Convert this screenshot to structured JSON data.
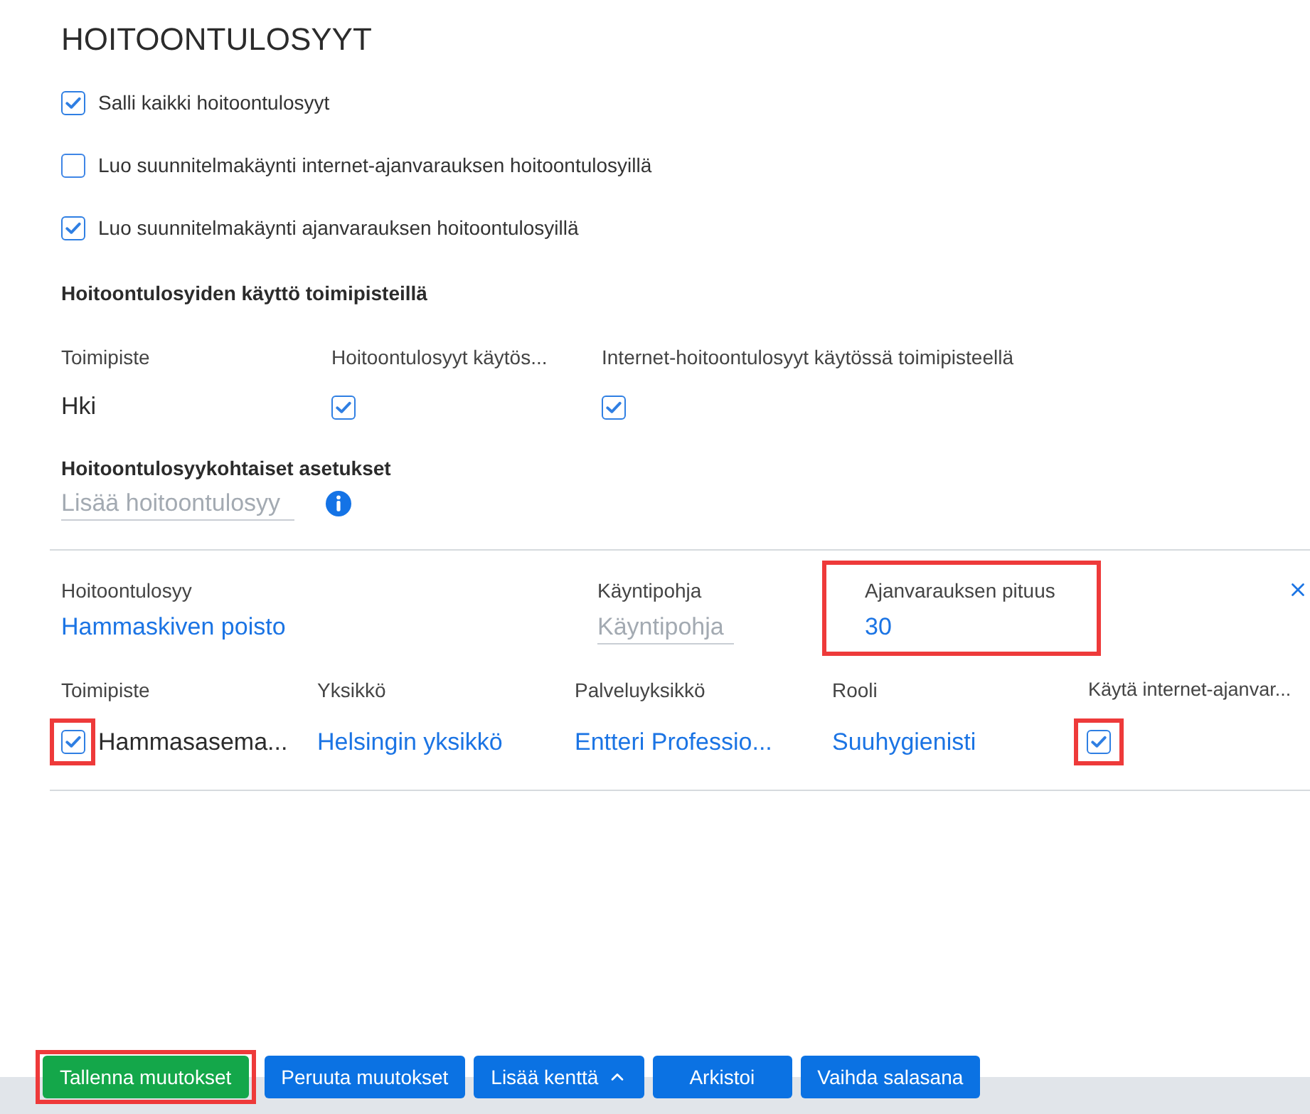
{
  "title": "HOITOONTULOSYYT",
  "options": [
    {
      "label": "Salli kaikki hoitoontulosyyt",
      "checked": true
    },
    {
      "label": "Luo suunnitelmakäynti internet-ajanvarauksen hoitoontulosyillä",
      "checked": false
    },
    {
      "label": "Luo suunnitelmakäynti ajanvarauksen hoitoontulosyillä",
      "checked": true
    }
  ],
  "locations": {
    "heading": "Hoitoontulosyiden käyttö toimipisteillä",
    "columns": [
      "Toimipiste",
      "Hoitoontulosyyt käytös...",
      "Internet-hoitoontulosyyt käytössä toimipisteellä"
    ],
    "rows": [
      {
        "location": "Hki",
        "enabled": true,
        "internet_enabled": true
      }
    ]
  },
  "reason_settings": {
    "heading": "Hoitoontulosyykohtaiset asetukset",
    "add_field": {
      "placeholder": "Lisää hoitoontulosyy"
    },
    "items": [
      {
        "fields": [
          {
            "label": "Hoitoontulosyy",
            "value": "Hammaskiven poisto",
            "highlighted": false
          },
          {
            "label": "Käyntipohja",
            "placeholder": "Käyntipohja",
            "highlighted": false
          },
          {
            "label": "Ajanvarauksen pituus",
            "value": "30",
            "highlighted": true
          }
        ],
        "columns": [
          "Toimipiste",
          "Yksikkö",
          "Palveluyksikkö",
          "Rooli",
          "Käytä internet-ajanvar..."
        ],
        "rows": [
          {
            "checkbox": {
              "checked": true,
              "highlighted": true
            },
            "location": "Hammasasema...",
            "unit": "Helsingin yksikkö",
            "service_unit": "Entteri Professio...",
            "role": "Suuhygienisti",
            "internet_booking": {
              "checked": true,
              "highlighted": true
            }
          }
        ]
      }
    ]
  },
  "buttons": [
    {
      "label": "Tallenna muutokset",
      "kind": "success",
      "highlighted": true
    },
    {
      "label": "Peruuta muutokset",
      "kind": "primary",
      "highlighted": false
    },
    {
      "label": "Lisää kenttä",
      "kind": "dropdown",
      "highlighted": false
    },
    {
      "label": "Arkistoi",
      "kind": "primary",
      "highlighted": false
    },
    {
      "label": "Vaihda salasana",
      "kind": "primary",
      "highlighted": false
    }
  ]
}
